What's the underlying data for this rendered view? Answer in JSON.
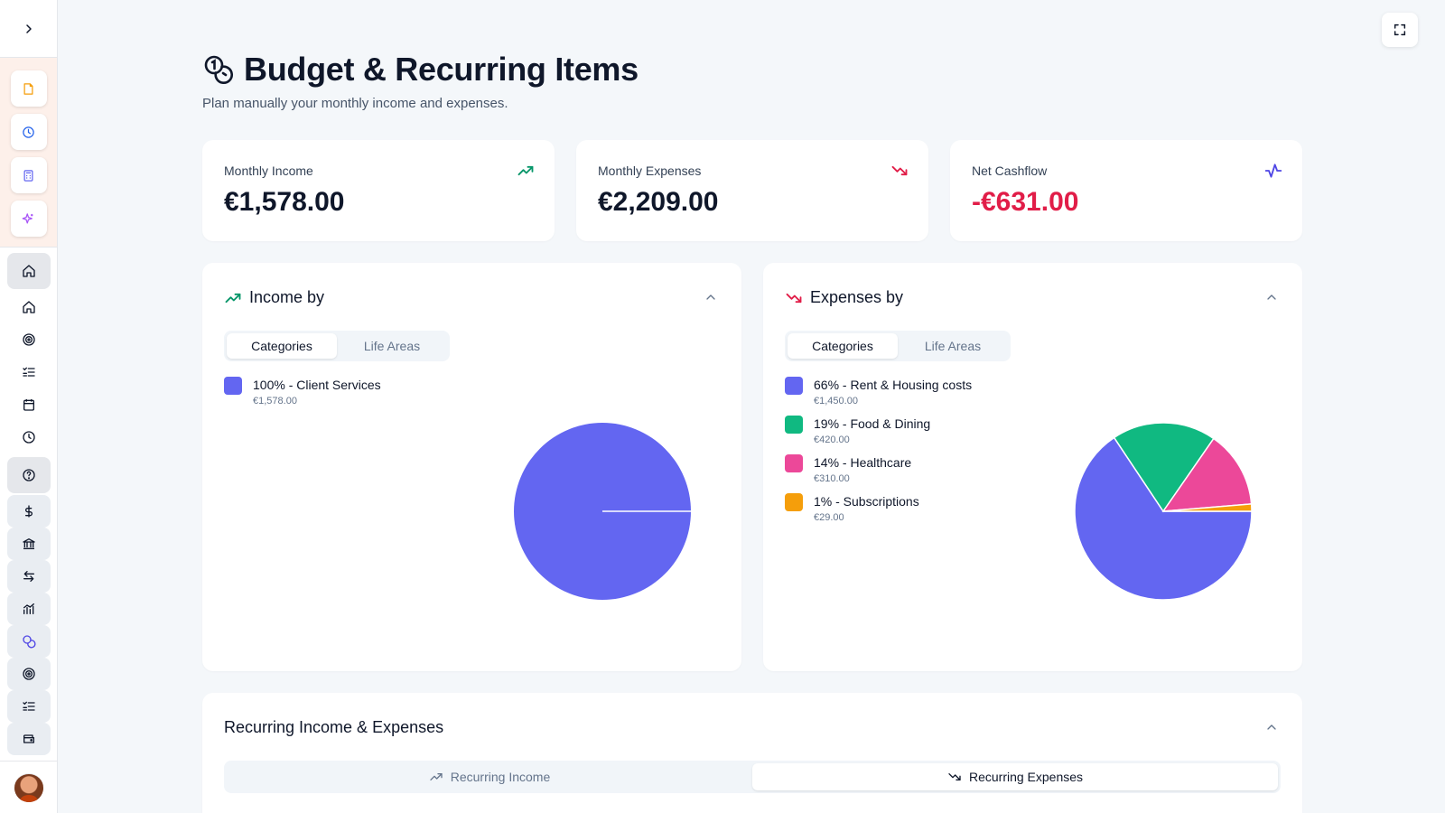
{
  "header": {
    "title": "Budget & Recurring Items",
    "subtitle": "Plan manually your monthly income and expenses.",
    "title_icon": "coins-icon"
  },
  "stats": [
    {
      "label": "Monthly Income",
      "value": "€1,578.00",
      "icon": "trending-up-icon",
      "color": "#059669"
    },
    {
      "label": "Monthly Expenses",
      "value": "€2,209.00",
      "icon": "trending-down-icon",
      "color": "#e11d48"
    },
    {
      "label": "Net Cashflow",
      "value": "-€631.00",
      "icon": "activity-icon",
      "color": "#4f46e5"
    }
  ],
  "income_card": {
    "title": "Income by",
    "tabs": [
      "Categories",
      "Life Areas"
    ],
    "items": [
      {
        "label": "100% - Client Services",
        "amount": "€1,578.00",
        "color": "#6366f1"
      }
    ]
  },
  "expenses_card": {
    "title": "Expenses by",
    "tabs": [
      "Categories",
      "Life Areas"
    ],
    "items": [
      {
        "label": "66% - Rent & Housing costs",
        "amount": "€1,450.00",
        "color": "#6366f1"
      },
      {
        "label": "19% - Food & Dining",
        "amount": "€420.00",
        "color": "#10b981"
      },
      {
        "label": "14% - Healthcare",
        "amount": "€310.00",
        "color": "#ec4899"
      },
      {
        "label": "1% - Subscriptions",
        "amount": "€29.00",
        "color": "#f59e0b"
      }
    ]
  },
  "recurring": {
    "title": "Recurring Income & Expenses",
    "tabs": [
      "Recurring Income",
      "Recurring Expenses"
    ],
    "active_tab": 1
  },
  "chart_data": [
    {
      "type": "pie",
      "categories": [
        "Client Services"
      ],
      "values": [
        1578
      ],
      "colors": [
        "#6366f1"
      ]
    },
    {
      "type": "pie",
      "categories": [
        "Rent & Housing costs",
        "Food & Dining",
        "Healthcare",
        "Subscriptions"
      ],
      "values": [
        1450,
        420,
        310,
        29
      ],
      "colors": [
        "#6366f1",
        "#10b981",
        "#ec4899",
        "#f59e0b"
      ]
    }
  ],
  "colors": {
    "accent": "#6366f1",
    "positive": "#059669",
    "negative": "#e11d48",
    "background": "#f4f7fa"
  }
}
